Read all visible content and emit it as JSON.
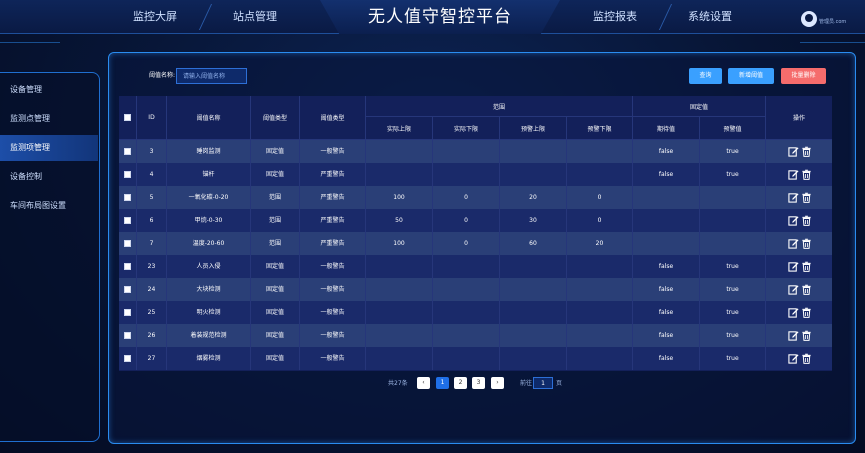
{
  "header": {
    "title": "无人值守智控平台",
    "nav_left": [
      "监控大屏",
      "站点管理"
    ],
    "nav_right": [
      "监控报表",
      "系统设置"
    ],
    "user_name": "管理员.com"
  },
  "sidebar": {
    "items": [
      "设备管理",
      "监测点管理",
      "监测项管理",
      "设备控制",
      "车间布局图设置"
    ],
    "active_index": 2
  },
  "filter": {
    "label": "阈值名称:",
    "placeholder": "请输入阈值名称",
    "value": ""
  },
  "toolbar": {
    "query": "查询",
    "add": "新增阈值",
    "batch_delete": "批量删除"
  },
  "table": {
    "headers": {
      "id": "ID",
      "name": "阈值名称",
      "type": "阈值类型",
      "level": "阈值类型",
      "range": "范围",
      "range_cols": [
        "实际上限",
        "实际下限",
        "预警上限",
        "预警下限"
      ],
      "fixed": "固定值",
      "fixed_cols": [
        "期待值",
        "预警值"
      ],
      "ops": "操作"
    },
    "rows": [
      {
        "id": "3",
        "name": "睡岗监测",
        "type": "固定值",
        "level": "一般警告",
        "r1": "",
        "r2": "",
        "r3": "",
        "r4": "",
        "expect": "false",
        "warn": "true"
      },
      {
        "id": "4",
        "name": "锚杆",
        "type": "固定值",
        "level": "严重警告",
        "r1": "",
        "r2": "",
        "r3": "",
        "r4": "",
        "expect": "false",
        "warn": "true"
      },
      {
        "id": "5",
        "name": "一氧化碳-0-20",
        "type": "范围",
        "level": "严重警告",
        "r1": "100",
        "r2": "0",
        "r3": "20",
        "r4": "0",
        "expect": "",
        "warn": ""
      },
      {
        "id": "6",
        "name": "甲烷-0-30",
        "type": "范围",
        "level": "严重警告",
        "r1": "50",
        "r2": "0",
        "r3": "30",
        "r4": "0",
        "expect": "",
        "warn": ""
      },
      {
        "id": "7",
        "name": "温度-20-60",
        "type": "范围",
        "level": "严重警告",
        "r1": "100",
        "r2": "0",
        "r3": "60",
        "r4": "20",
        "expect": "",
        "warn": ""
      },
      {
        "id": "23",
        "name": "人员入侵",
        "type": "固定值",
        "level": "一般警告",
        "r1": "",
        "r2": "",
        "r3": "",
        "r4": "",
        "expect": "false",
        "warn": "true"
      },
      {
        "id": "24",
        "name": "大块检测",
        "type": "固定值",
        "level": "一般警告",
        "r1": "",
        "r2": "",
        "r3": "",
        "r4": "",
        "expect": "false",
        "warn": "true"
      },
      {
        "id": "25",
        "name": "明火检测",
        "type": "固定值",
        "level": "一般警告",
        "r1": "",
        "r2": "",
        "r3": "",
        "r4": "",
        "expect": "false",
        "warn": "true"
      },
      {
        "id": "26",
        "name": "着装规范检测",
        "type": "固定值",
        "level": "一般警告",
        "r1": "",
        "r2": "",
        "r3": "",
        "r4": "",
        "expect": "false",
        "warn": "true"
      },
      {
        "id": "27",
        "name": "烟雾检测",
        "type": "固定值",
        "level": "一般警告",
        "r1": "",
        "r2": "",
        "r3": "",
        "r4": "",
        "expect": "false",
        "warn": "true"
      }
    ]
  },
  "pagination": {
    "total": "共27条",
    "pages": [
      "1",
      "2",
      "3"
    ],
    "active": "1",
    "prev": "‹",
    "next": "›",
    "goto_label": "前往",
    "goto_value": "1",
    "page_suffix": "页"
  },
  "icons": {
    "edit": "edit-icon",
    "delete": "trash-icon",
    "user": "user-avatar-icon"
  },
  "colors": {
    "accent": "#3aa0ff",
    "danger": "#f56c6c",
    "header_bg": "#0e2559",
    "row_even": "#1a2a6a",
    "row_odd": "#2a3f77"
  }
}
